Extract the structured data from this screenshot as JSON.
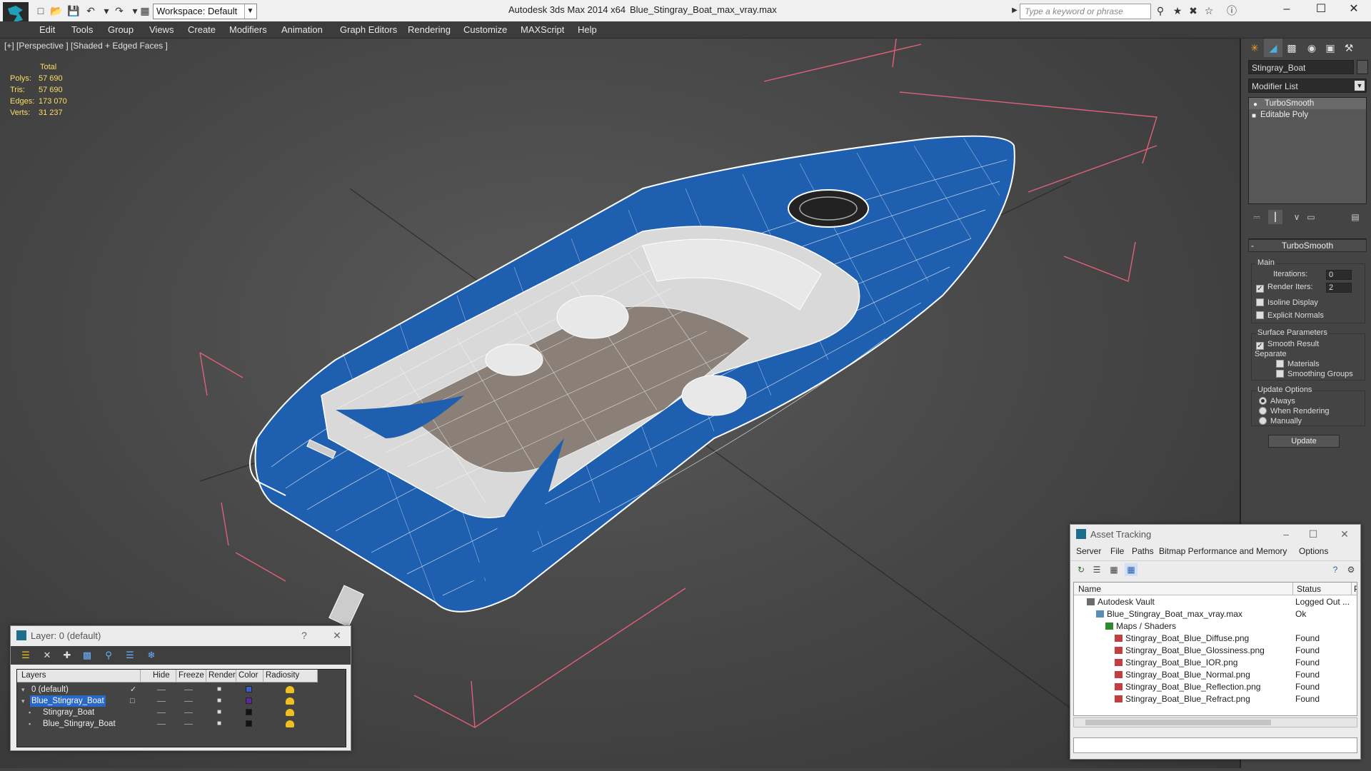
{
  "titlebar": {
    "workspace": "Workspace: Default",
    "app_title": "Autodesk 3ds Max 2014 x64",
    "doc_title": "Blue_Stingray_Boat_max_vray.max",
    "search_placeholder": "Type a keyword or phrase"
  },
  "menu": [
    "Edit",
    "Tools",
    "Group",
    "Views",
    "Create",
    "Modifiers",
    "Animation",
    "Graph Editors",
    "Rendering",
    "Customize",
    "MAXScript",
    "Help"
  ],
  "viewport": {
    "label": "[+] [Perspective ] [Shaded + Edged Faces ]",
    "stats": {
      "header": "Total",
      "polys_label": "Polys:",
      "polys": "57 690",
      "tris_label": "Tris:",
      "tris": "57 690",
      "edges_label": "Edges:",
      "edges": "173 070",
      "verts_label": "Verts:",
      "verts": "31 237"
    },
    "colors": {
      "hull": "#1f5fb0",
      "wire": "#ffffff",
      "bbox": "#e0607a",
      "floor": "#8a8078"
    }
  },
  "command_panel": {
    "object_name": "Stingray_Boat",
    "modifier_list": "Modifier List",
    "stack": [
      "TurboSmooth",
      "Editable Poly"
    ],
    "rollout_title": "TurboSmooth",
    "main_group": "Main",
    "iterations_label": "Iterations:",
    "iterations": "0",
    "render_iters_label": "Render Iters:",
    "render_iters": "2",
    "isoline": "Isoline Display",
    "explicit_normals": "Explicit Normals",
    "surface_group": "Surface Parameters",
    "smooth_result": "Smooth Result",
    "separate": "Separate",
    "materials": "Materials",
    "smoothing_groups": "Smoothing Groups",
    "update_group": "Update Options",
    "always": "Always",
    "when_rendering": "When Rendering",
    "manually": "Manually",
    "update_button": "Update"
  },
  "asset_tracking": {
    "title": "Asset Tracking",
    "menu": [
      "Server",
      "File",
      "Paths",
      "Bitmap Performance and Memory",
      "Options"
    ],
    "col_name": "Name",
    "col_status": "Status",
    "col_p": "P",
    "rows": [
      {
        "name": "Autodesk Vault",
        "status": "Logged Out ...",
        "indent": 0,
        "icon": "vault"
      },
      {
        "name": "Blue_Stingray_Boat_max_vray.max",
        "status": "Ok",
        "indent": 1,
        "icon": "max"
      },
      {
        "name": "Maps / Shaders",
        "status": "",
        "indent": 2,
        "icon": "folder"
      },
      {
        "name": "Stingray_Boat_Blue_Diffuse.png",
        "status": "Found",
        "indent": 3,
        "icon": "img"
      },
      {
        "name": "Stingray_Boat_Blue_Glossiness.png",
        "status": "Found",
        "indent": 3,
        "icon": "img"
      },
      {
        "name": "Stingray_Boat_Blue_IOR.png",
        "status": "Found",
        "indent": 3,
        "icon": "img"
      },
      {
        "name": "Stingray_Boat_Blue_Normal.png",
        "status": "Found",
        "indent": 3,
        "icon": "img"
      },
      {
        "name": "Stingray_Boat_Blue_Reflection.png",
        "status": "Found",
        "indent": 3,
        "icon": "img"
      },
      {
        "name": "Stingray_Boat_Blue_Refract.png",
        "status": "Found",
        "indent": 3,
        "icon": "img"
      }
    ]
  },
  "layers": {
    "title": "Layer: 0 (default)",
    "help": "?",
    "cols": [
      "Layers",
      "Hide",
      "Freeze",
      "Render",
      "Color",
      "Radiosity"
    ],
    "rows": [
      {
        "name": "0 (default)",
        "indent": 0,
        "color": "#3a5fc8",
        "checked": true,
        "selected": false
      },
      {
        "name": "Blue_Stingray_Boat",
        "indent": 0,
        "color": "#5a2a9a",
        "checked": false,
        "selected": true
      },
      {
        "name": "Stingray_Boat",
        "indent": 1,
        "color": "#111111",
        "checked": false,
        "selected": false
      },
      {
        "name": "Blue_Stingray_Boat",
        "indent": 1,
        "color": "#111111",
        "checked": false,
        "selected": false
      }
    ]
  }
}
